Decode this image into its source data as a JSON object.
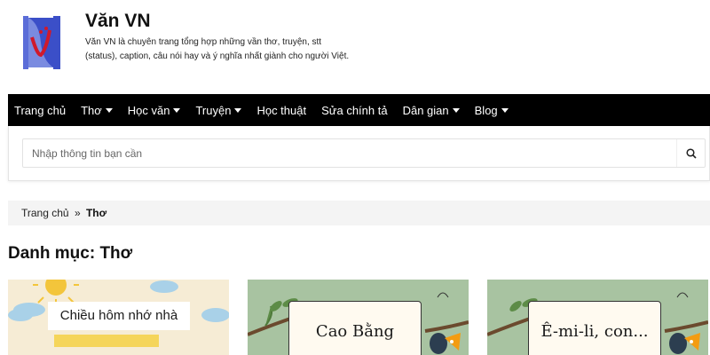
{
  "header": {
    "site_title": "Văn VN",
    "site_description": "Văn VN là chuyên trang tổng hợp những vần thơ, truyện, stt (status), caption, câu nói hay và ý nghĩa nhất giành cho người Việt."
  },
  "nav": {
    "items": [
      {
        "label": "Trang chủ",
        "has_dropdown": false
      },
      {
        "label": "Thơ",
        "has_dropdown": true
      },
      {
        "label": "Học văn",
        "has_dropdown": true
      },
      {
        "label": "Truyện",
        "has_dropdown": true
      },
      {
        "label": "Học thuật",
        "has_dropdown": false
      },
      {
        "label": "Sửa chính tả",
        "has_dropdown": false
      },
      {
        "label": "Dân gian",
        "has_dropdown": true
      },
      {
        "label": "Blog",
        "has_dropdown": true
      }
    ]
  },
  "search": {
    "placeholder": "Nhập thông tin bạn cần",
    "value": "",
    "icon": "search-icon"
  },
  "breadcrumb": {
    "home": "Trang chủ",
    "separator": "»",
    "current": "Thơ"
  },
  "page_title": "Danh mục: Thơ",
  "cards": [
    {
      "label": "Chiều hôm nhớ nhà"
    },
    {
      "label": "Cao Bằng"
    },
    {
      "label": "Ê-mi-li, con..."
    }
  ],
  "colors": {
    "nav_background": "#000000",
    "card_green": "#a8c3a1",
    "card_cream": "#f6ecd5",
    "logo_blue": "#3b4fc8",
    "logo_red": "#d0192b"
  }
}
